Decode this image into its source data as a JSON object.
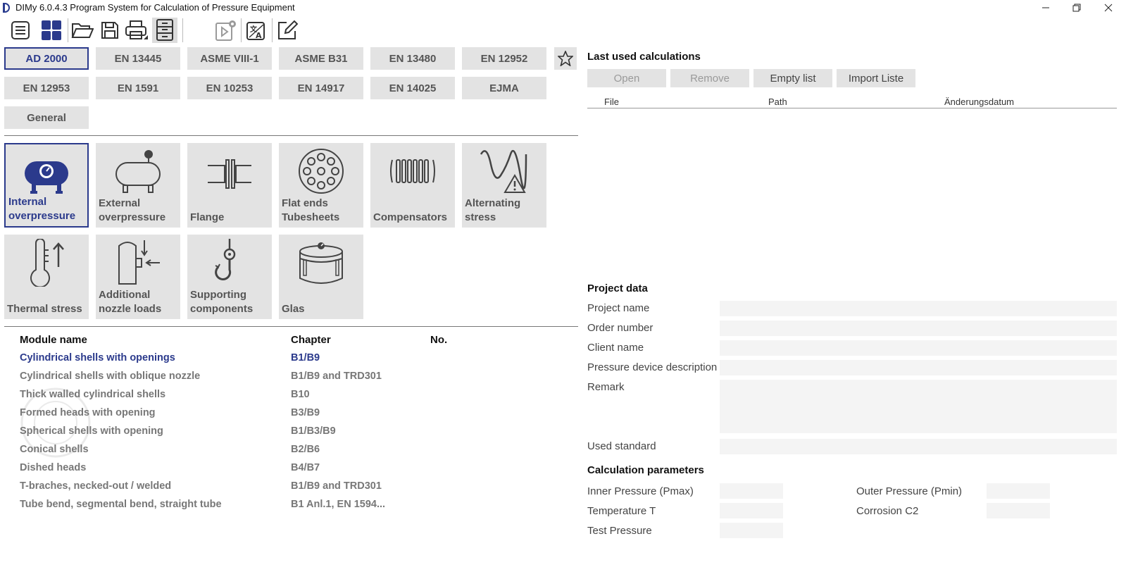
{
  "window": {
    "title": "DIMy 6.0.4.3 Program System for Calculation of Pressure Equipment"
  },
  "toolbar": {
    "icons": [
      "menu-icon",
      "grid-icon",
      "folder-open-icon",
      "save-icon",
      "print-icon",
      "cabinet-icon",
      "run-settings-icon",
      "translate-icon",
      "edit-icon"
    ]
  },
  "standards": {
    "items": [
      "AD 2000",
      "EN 13445",
      "ASME VIII-1",
      "ASME B31",
      "EN 13480",
      "EN 12952",
      "EN 12953",
      "EN 1591",
      "EN 10253",
      "EN 14917",
      "EN 14025",
      "EJMA",
      "General"
    ],
    "selected": "AD 2000"
  },
  "categories": {
    "items": [
      {
        "line1": "Internal",
        "line2": "overpressure"
      },
      {
        "line1": "External",
        "line2": "overpressure"
      },
      {
        "line1": "",
        "line2": "Flange"
      },
      {
        "line1": "Flat ends",
        "line2": "Tubesheets"
      },
      {
        "line1": "",
        "line2": "Compensators"
      },
      {
        "line1": "Alternating",
        "line2": "stress"
      },
      {
        "line1": "",
        "line2": "Thermal stress"
      },
      {
        "line1": "Additional",
        "line2": "nozzle loads"
      },
      {
        "line1": "Supporting",
        "line2": "components"
      },
      {
        "line1": "",
        "line2": "Glas"
      }
    ],
    "selected": "Internal overpressure"
  },
  "modules": {
    "headers": {
      "name": "Module name",
      "chapter": "Chapter",
      "no": "No."
    },
    "rows": [
      {
        "name": "Cylindrical shells with openings",
        "chapter": "B1/B9"
      },
      {
        "name": "Cylindrical shells with oblique nozzle",
        "chapter": "B1/B9 and TRD301"
      },
      {
        "name": "Thick walled cylindrical shells",
        "chapter": "B10"
      },
      {
        "name": "Formed heads with opening",
        "chapter": "B3/B9"
      },
      {
        "name": "Spherical shells with opening",
        "chapter": "B1/B3/B9"
      },
      {
        "name": "Conical shells",
        "chapter": "B2/B6"
      },
      {
        "name": "Dished heads",
        "chapter": "B4/B7"
      },
      {
        "name": "T-braches, necked-out / welded",
        "chapter": "B1/B9 and TRD301"
      },
      {
        "name": "Tube bend, segmental bend, straight tube",
        "chapter": "B1 Anl.1, EN 1594..."
      }
    ]
  },
  "recent": {
    "title": "Last used calculations",
    "buttons": {
      "open": "Open",
      "remove": "Remove",
      "empty": "Empty list",
      "import": "Import Liste"
    },
    "columns": {
      "file": "File",
      "path": "Path",
      "date": "Änderungsdatum"
    }
  },
  "project": {
    "title": "Project data",
    "labels": {
      "project_name": "Project name",
      "order_number": "Order number",
      "client_name": "Client name",
      "device_description": "Pressure device description",
      "remark": "Remark",
      "used_standard": "Used standard"
    }
  },
  "calc": {
    "title": "Calculation parameters",
    "labels": {
      "inner_pressure": "Inner Pressure (Pmax)",
      "outer_pressure": "Outer Pressure (Pmin)",
      "temperature": "Temperature T",
      "corrosion": "Corrosion C2",
      "test_pressure": "Test Pressure"
    }
  },
  "colors": {
    "accent": "#2b3a8c",
    "tile_bg": "#e3e3e3"
  }
}
